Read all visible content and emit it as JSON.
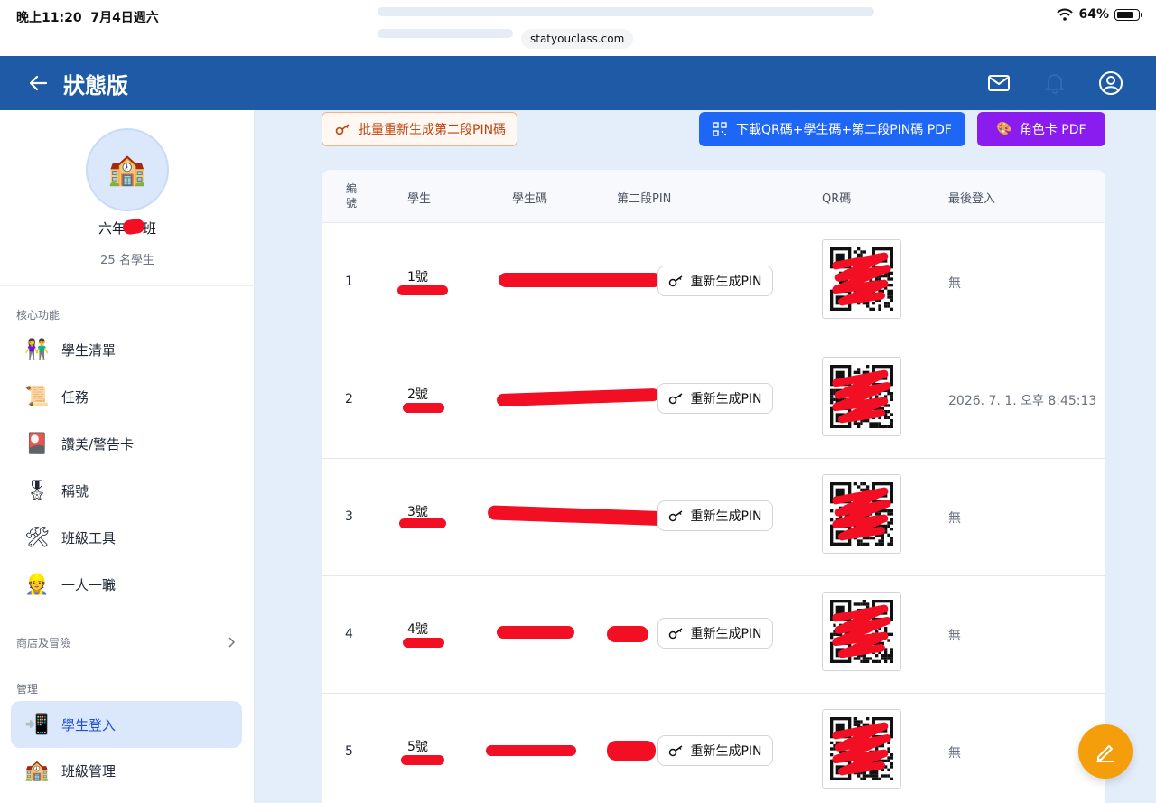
{
  "status_bar": {
    "time": "晚上11:20",
    "date": "7月4日週六",
    "battery": "64%"
  },
  "browser": {
    "url": "statyouclass.com"
  },
  "header": {
    "title": "狀態版",
    "colors": {
      "bar": "#1f5aa6"
    }
  },
  "sidebar": {
    "class_name": "六年",
    "class_name_suffix": "班",
    "student_count": "25 名學生",
    "sections": {
      "core": "核心功能",
      "shop": "商店及冒險",
      "manage": "管理"
    },
    "items": [
      {
        "label": "學生清單",
        "icon": "students-icon"
      },
      {
        "label": "任務",
        "icon": "scroll-icon"
      },
      {
        "label": "讚美/警告卡",
        "icon": "cards-icon"
      },
      {
        "label": "稱號",
        "icon": "medal-icon"
      },
      {
        "label": "班級工具",
        "icon": "tools-icon"
      },
      {
        "label": "一人一職",
        "icon": "worker-icon"
      },
      {
        "label": "學生登入",
        "icon": "phone-login-icon",
        "active": true
      },
      {
        "label": "班級管理",
        "icon": "school-icon"
      }
    ]
  },
  "toolbar": {
    "regen_all": "批量重新生成第二段PIN碼",
    "download": "下載QR碼+學生碼+第二段PIN碼 PDF",
    "role_card": "角色卡 PDF"
  },
  "table": {
    "headers": {
      "num": "編號",
      "student": "學生",
      "code": "學生碼",
      "pin": "第二段PIN",
      "qr": "QR碼",
      "last_login": "最後登入"
    },
    "regen_label": "重新生成PIN",
    "rows": [
      {
        "num": "1",
        "student": "1號",
        "last_login": "無"
      },
      {
        "num": "2",
        "student": "2號",
        "last_login": "2026. 7. 1. 오후 8:45:13"
      },
      {
        "num": "3",
        "student": "3號",
        "last_login": "無"
      },
      {
        "num": "4",
        "student": "4號",
        "last_login": "無"
      },
      {
        "num": "5",
        "student": "5號",
        "last_login": "無"
      }
    ]
  }
}
